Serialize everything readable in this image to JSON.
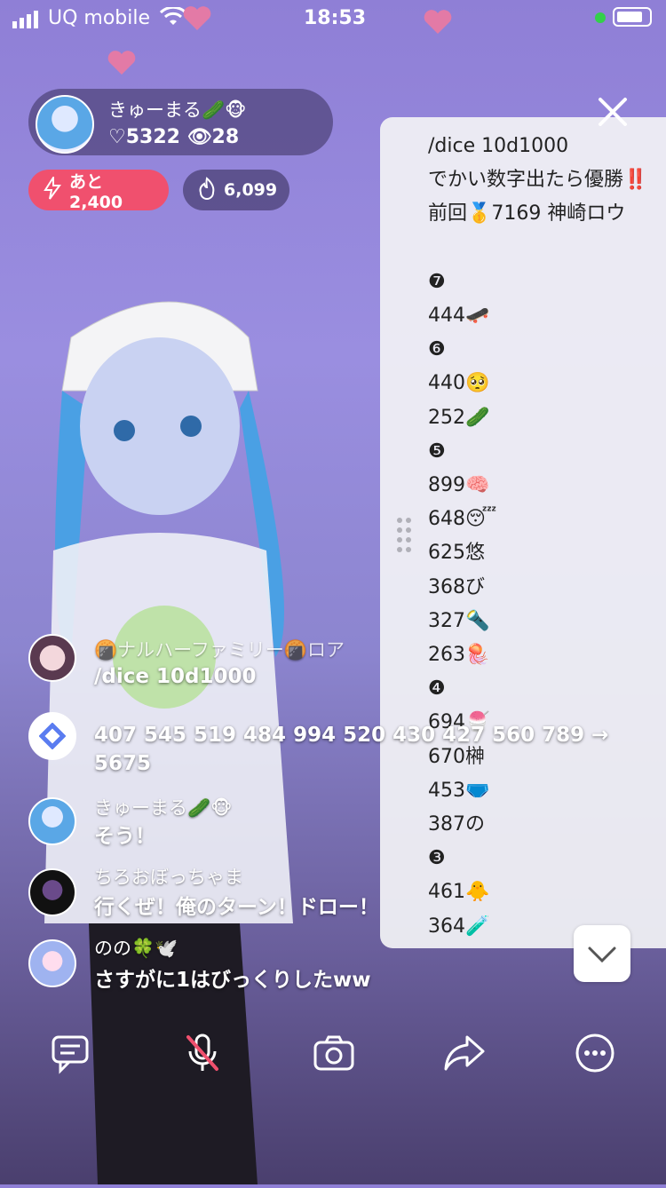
{
  "status_bar": {
    "carrier": "UQ mobile",
    "time": "18:53"
  },
  "streamer": {
    "name": "きゅーまる🥒🐵",
    "likes": "♡5322",
    "viewers": "👁28"
  },
  "badges": {
    "remaining": "あと2,400",
    "fire": "6,099"
  },
  "panel": {
    "lines": [
      "/dice 10d1000",
      "でかい数字出たら優勝‼️",
      "前回🥇7169 神崎ロウ",
      "",
      "❼",
      "444🛹",
      "❻",
      "440🥺",
      "252🥒",
      "❺",
      "899🧠",
      "648😴",
      "625悠",
      "368び",
      "327🔦",
      "263🪼",
      "❹",
      "694🍧",
      "670榊",
      "453🩲",
      "387の",
      "❸",
      "461🐥",
      "364🧪"
    ]
  },
  "chat": [
    {
      "user": "🍘ナルハーファミリー🍘ロア",
      "text": "/dice 10d1000"
    },
    {
      "user": "",
      "text": "407 545 519 484 994 520 430 427 560 789 → 5675"
    },
    {
      "user": "きゅーまる🥒🐵",
      "text": "そう！"
    },
    {
      "user": "ちろおぼっちゃま",
      "text": "行くぜ！俺のターン！ドロー！"
    },
    {
      "user": "のの🍀🕊️",
      "text": "さすがに1はびっくりしたww"
    }
  ],
  "colors": {
    "accent_pink": "#f0506e",
    "panel_bg": "#f0f0f4",
    "card_bg": "#463c6e"
  }
}
